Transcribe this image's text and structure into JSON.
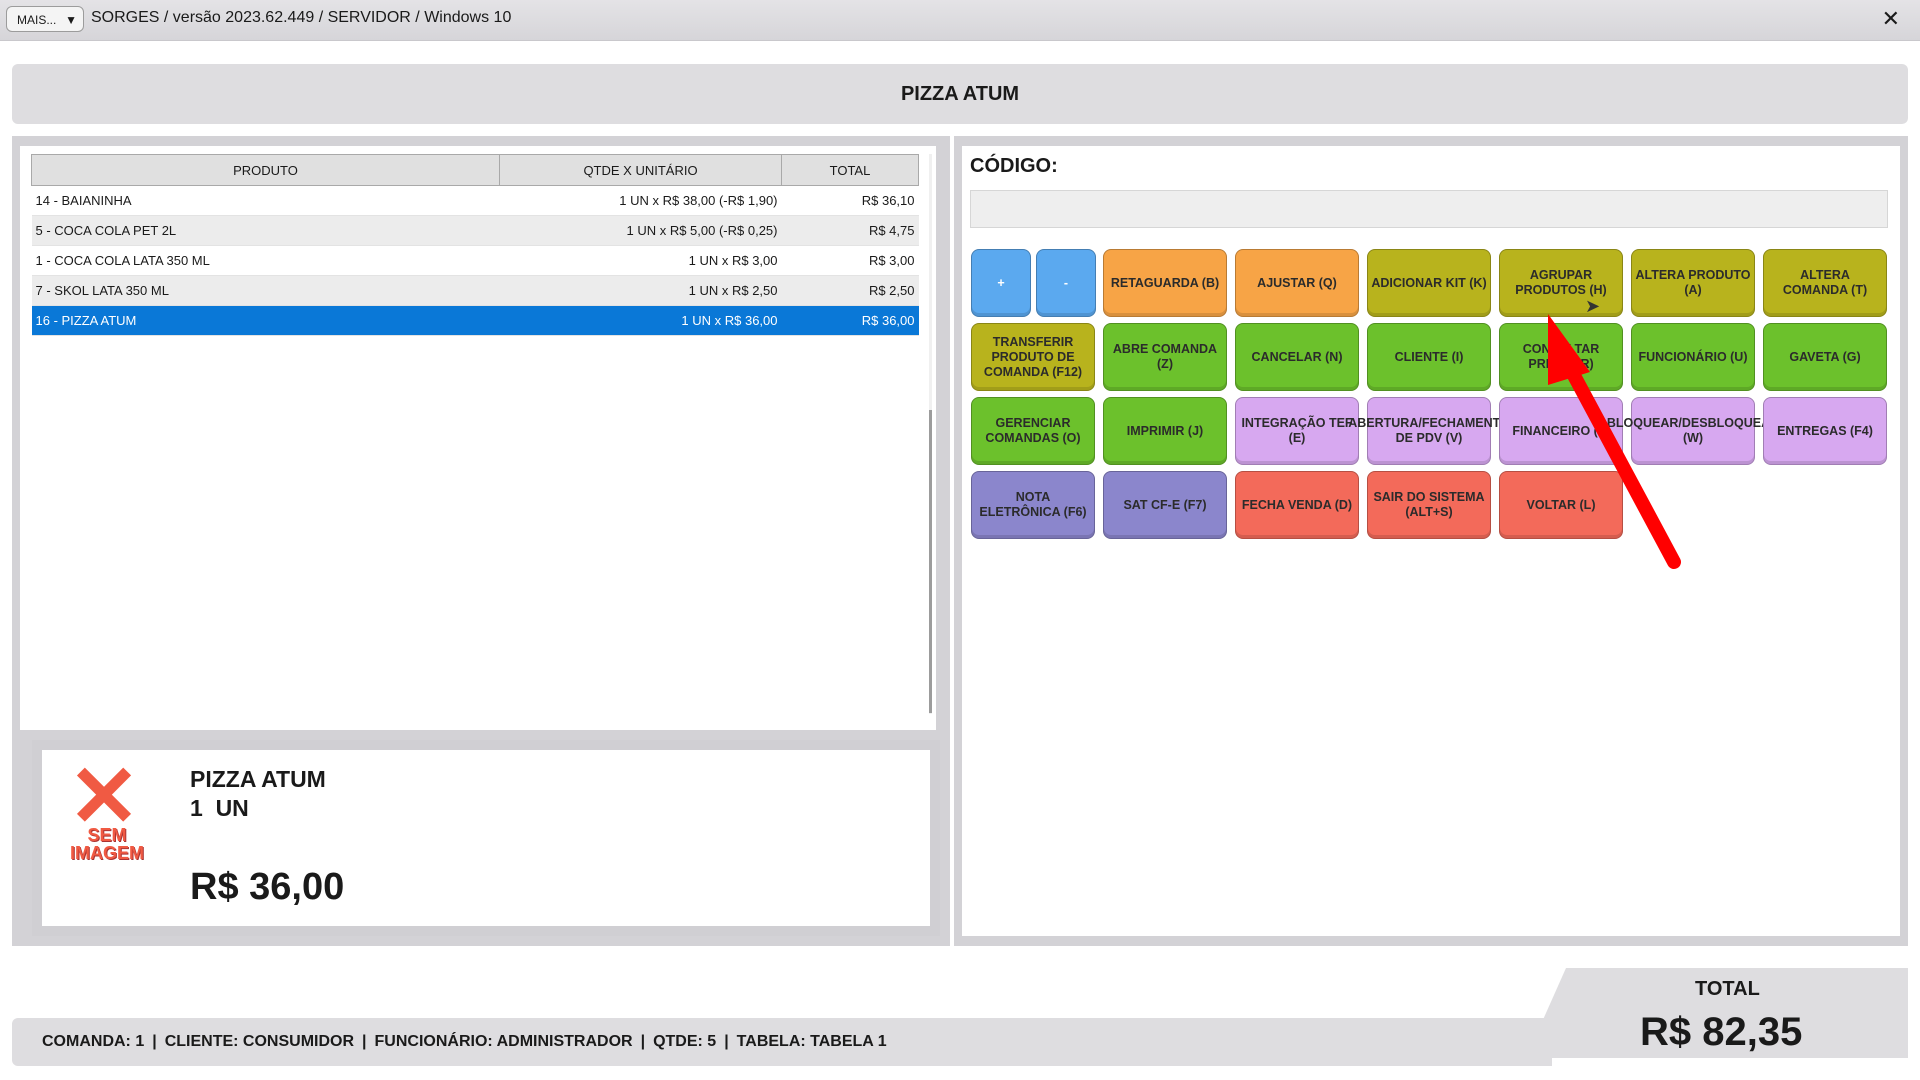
{
  "titlebar": {
    "more_label": "MAIS...",
    "title": "SORGES / versão 2023.62.449 / SERVIDOR / Windows 10",
    "close_icon": "close-icon"
  },
  "product_header": "PIZZA ATUM",
  "table": {
    "columns": [
      "PRODUTO",
      "QTDE X UNITÁRIO",
      "TOTAL"
    ],
    "rows": [
      {
        "produto": "14 - BAIANINHA",
        "qtde": "1 UN x R$ 38,00 (-R$ 1,90)",
        "total": "R$ 36,10"
      },
      {
        "produto": "5 - COCA COLA PET 2L",
        "qtde": "1 UN x R$ 5,00 (-R$ 0,25)",
        "total": "R$ 4,75"
      },
      {
        "produto": "1 - COCA COLA LATA 350 ML",
        "qtde": "1 UN x R$ 3,00",
        "total": "R$ 3,00"
      },
      {
        "produto": "7 - SKOL LATA 350 ML",
        "qtde": "1 UN x R$ 2,50",
        "total": "R$ 2,50"
      },
      {
        "produto": "16 - PIZZA ATUM",
        "qtde": "1 UN x R$ 36,00",
        "total": "R$ 36,00"
      }
    ],
    "selected_index": 4
  },
  "detail": {
    "no_image_line1": "SEM",
    "no_image_line2": "IMAGEM",
    "name": "PIZZA ATUM",
    "qty": "1  UN",
    "price": "R$ 36,00"
  },
  "code": {
    "label": "CÓDIGO:",
    "value": ""
  },
  "buttons": [
    {
      "label": "+",
      "color": "#5ba9ef"
    },
    {
      "label": "-",
      "color": "#5ba9ef"
    },
    {
      "label": "RETAGUARDA (B)",
      "color": "#f7a446"
    },
    {
      "label": "AJUSTAR (Q)",
      "color": "#f7a446"
    },
    {
      "label": "ADICIONAR KIT (K)",
      "color": "#b8b31d"
    },
    {
      "label": "AGRUPAR PRODUTOS (H)",
      "color": "#b8b31d"
    },
    {
      "label": "ALTERA PRODUTO (A)",
      "color": "#b8b31d"
    },
    {
      "label": "ALTERA COMANDA (T)",
      "color": "#b8b31d"
    },
    {
      "label": "TRANSFERIR PRODUTO DE COMANDA (F12)",
      "color": "#b8b31d"
    },
    {
      "label": "ABRE COMANDA (Z)",
      "color": "#6cc12c"
    },
    {
      "label": "CANCELAR (N)",
      "color": "#6cc12c"
    },
    {
      "label": "CLIENTE (I)",
      "color": "#6cc12c"
    },
    {
      "label": "CONSULTAR PREÇO (R)",
      "color": "#6cc12c"
    },
    {
      "label": "FUNCIONÁRIO (U)",
      "color": "#6cc12c"
    },
    {
      "label": "GAVETA (G)",
      "color": "#6cc12c"
    },
    {
      "label": "GERENCIAR COMANDAS (O)",
      "color": "#6cc12c"
    },
    {
      "label": "IMPRIMIR (J)",
      "color": "#6cc12c"
    },
    {
      "label": "INTEGRAÇÃO TEF (E)",
      "color": "#d7a8f0"
    },
    {
      "label": "ABERTURA/FECHAMENTO DE PDV (V)",
      "color": "#d7a8f0"
    },
    {
      "label": "FINANCEIRO (F)",
      "color": "#d7a8f0"
    },
    {
      "label": "BLOQUEAR/DESBLOQUEAR (W)",
      "color": "#d7a8f0"
    },
    {
      "label": "ENTREGAS (F4)",
      "color": "#d7a8f0"
    },
    {
      "label": "NOTA ELETRÔNICA (F6)",
      "color": "#8b86cc"
    },
    {
      "label": "SAT CF-E (F7)",
      "color": "#8b86cc"
    },
    {
      "label": "FECHA VENDA (D)",
      "color": "#f36a5a"
    },
    {
      "label": "SAIR DO SISTEMA (ALT+S)",
      "color": "#f36a5a"
    },
    {
      "label": "VOLTAR (L)",
      "color": "#f36a5a"
    }
  ],
  "status": {
    "comanda": "COMANDA: 1",
    "cliente": "CLIENTE: CONSUMIDOR",
    "funcionario": "FUNCIONÁRIO: ADMINISTRADOR",
    "qtde": "QTDE: 5",
    "tabela": "TABELA: TABELA 1"
  },
  "total": {
    "label": "TOTAL",
    "value": "R$ 82,35"
  },
  "annotation": {
    "arrow_color": "#ff0000"
  }
}
